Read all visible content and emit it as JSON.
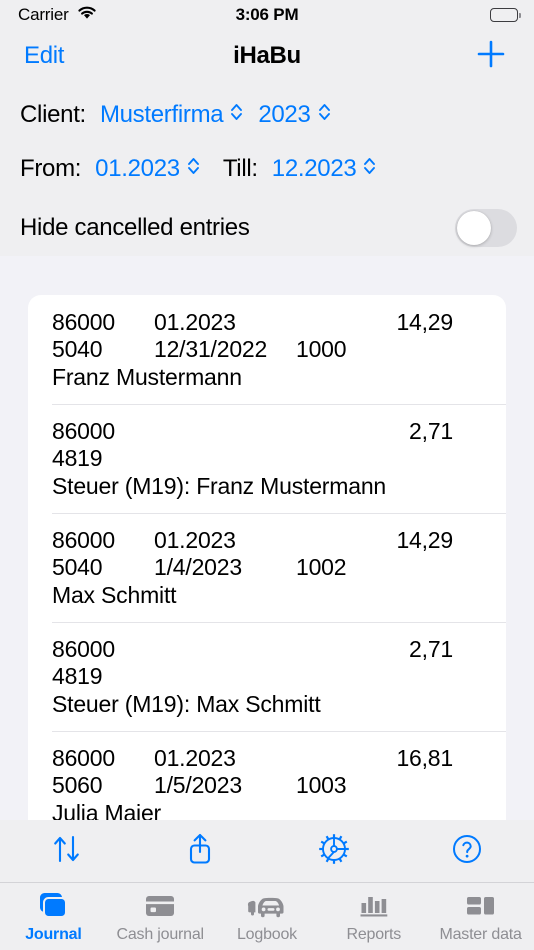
{
  "status_bar": {
    "carrier": "Carrier",
    "wifi_icon": "wifi-icon",
    "time": "3:06 PM",
    "battery_icon": "battery-icon"
  },
  "nav_bar": {
    "edit_label": "Edit",
    "title": "iHaBu",
    "add_icon": "plus-icon"
  },
  "filters": {
    "client_label": "Client:",
    "client_value": "Musterfirma",
    "year_value": "2023",
    "from_label": "From:",
    "from_value": "01.2023",
    "till_label": "Till:",
    "till_value": "12.2023",
    "chevron_icon": "chevron-up-down-icon",
    "hide_cancelled_label": "Hide cancelled entries",
    "hide_cancelled_on": false
  },
  "entries": [
    {
      "account": "86000",
      "period": "01.2023",
      "amount": "14,29",
      "contra_account": "5040",
      "date": "12/31/2022",
      "doc_number": "1000",
      "description": "Franz Mustermann"
    },
    {
      "account": "86000",
      "period": "",
      "amount": "2,71",
      "contra_account": "4819",
      "date": "",
      "doc_number": "",
      "description": "Steuer (M19): Franz Mustermann"
    },
    {
      "account": "86000",
      "period": "01.2023",
      "amount": "14,29",
      "contra_account": "5040",
      "date": "1/4/2023",
      "doc_number": "1002",
      "description": "Max Schmitt"
    },
    {
      "account": "86000",
      "period": "",
      "amount": "2,71",
      "contra_account": "4819",
      "date": "",
      "doc_number": "",
      "description": "Steuer (M19): Max Schmitt"
    },
    {
      "account": "86000",
      "period": "01.2023",
      "amount": "16,81",
      "contra_account": "5060",
      "date": "1/5/2023",
      "doc_number": "1003",
      "description": "Julia Maier"
    }
  ],
  "toolbar": {
    "sort_icon": "sort-arrows-icon",
    "share_icon": "share-icon",
    "settings_icon": "gear-icon",
    "help_icon": "question-mark-circle-icon"
  },
  "tabs": [
    {
      "label": "Journal",
      "icon": "stacked-cards-icon",
      "active": true
    },
    {
      "label": "Cash journal",
      "icon": "card-icon",
      "active": false
    },
    {
      "label": "Logbook",
      "icon": "car-icon",
      "active": false
    },
    {
      "label": "Reports",
      "icon": "bar-chart-icon",
      "active": false
    },
    {
      "label": "Master data",
      "icon": "grid-blocks-icon",
      "active": false
    }
  ],
  "colors": {
    "accent": "#007aff",
    "background": "#f2f2f7",
    "panel": "#efeff1",
    "card": "#ffffff",
    "inactive_tab": "#8e8e93"
  }
}
